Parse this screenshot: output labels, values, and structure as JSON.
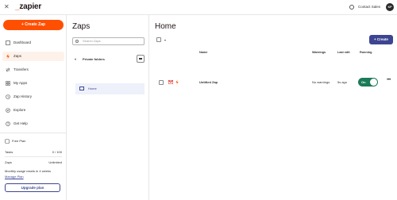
{
  "topbar": {
    "close_glyph": "✕",
    "logo": "zapier",
    "logo_prefix": "_",
    "contact_label": "Contact Sales",
    "avatar_initials": "KP"
  },
  "sidebar": {
    "create_label": "+ Create Zap",
    "items": [
      {
        "label": "Dashboard",
        "icon": "dashboard-icon"
      },
      {
        "label": "Zaps",
        "icon": "zap-icon",
        "active": true
      },
      {
        "label": "Transfers",
        "icon": "transfer-icon"
      },
      {
        "label": "My Apps",
        "icon": "apps-icon"
      },
      {
        "label": "Zap History",
        "icon": "history-icon"
      },
      {
        "label": "Explore",
        "icon": "explore-icon"
      },
      {
        "label": "Get Help",
        "icon": "help-icon"
      }
    ],
    "plan": {
      "name": "Free Plan",
      "tasks_label": "Tasks",
      "tasks_value": "0 / 100",
      "zaps_label": "Zaps",
      "zaps_value": "Unlimited",
      "usage_note": "Monthly usage resets in 4 weeks",
      "manage_link": "Manage Plan",
      "upgrade_label": "Upgrade plan"
    }
  },
  "folders": {
    "title": "Zaps",
    "search_placeholder": "Search Zaps",
    "section_label": "Private folders",
    "items": [
      {
        "label": "Home"
      }
    ]
  },
  "main": {
    "title": "Home",
    "create_label": "+ Create",
    "columns": {
      "name": "Name",
      "warnings": "Warnings",
      "last_edit": "Last edit",
      "running": "Running"
    },
    "rows": [
      {
        "name": "Untitled Zap",
        "warnings": "No warnings",
        "last_edit": "5s ago",
        "running_label": "On",
        "running": true
      }
    ]
  },
  "colors": {
    "accent": "#ff4f00",
    "primary": "#3d4592",
    "toggle_on": "#1d7b57"
  }
}
